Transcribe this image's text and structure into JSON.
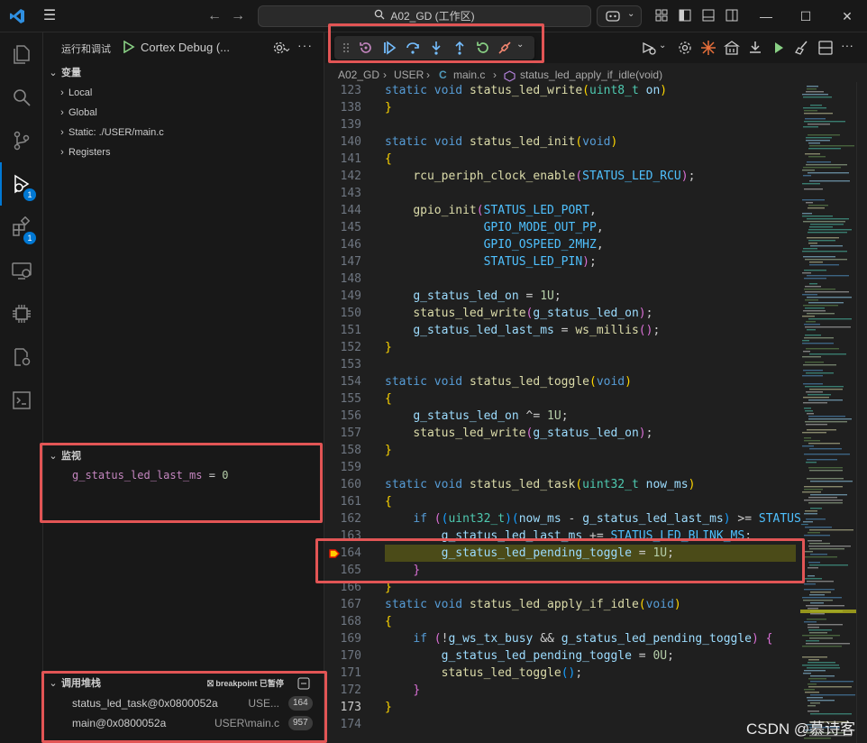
{
  "window": {
    "search_text": "A02_GD (工作区)"
  },
  "activity_bar": {
    "debug_badge": "1",
    "extensions_badge": "1"
  },
  "sidebar": {
    "title": "运行和调试",
    "config_name": "Cortex Debug (...",
    "variables": {
      "header": "变量",
      "scopes": [
        "Local",
        "Global",
        "Static: ./USER/main.c",
        "Registers"
      ]
    },
    "watch": {
      "header": "监视",
      "expression_name": "g_status_led_last_ms",
      "expression_eq": " = ",
      "expression_value": "0"
    },
    "call_stack": {
      "header": "调用堆栈",
      "status": "breakpoint 已暂停",
      "frames": [
        {
          "fn": "status_led_task@0x0800052a",
          "file": "USE...",
          "line": "164"
        },
        {
          "fn": "main@0x0800052a",
          "file": "USER\\main.c",
          "line": "957"
        }
      ]
    }
  },
  "breadcrumb": {
    "items": [
      "A02_GD",
      "USER",
      "main.c",
      "status_led_apply_if_idle(void)"
    ]
  },
  "code_lines": [
    {
      "n": "123",
      "html": "<span class=\"k\">static</span> <span class=\"k\">void</span> <span class=\"f\">status_led_write</span><span class=\"p1\">(</span><span class=\"t\">uint8_t</span> <span class=\"v\">on</span><span class=\"p1\">)</span>"
    },
    {
      "n": "138",
      "html": "<span class=\"p1\">}</span>"
    },
    {
      "n": "139",
      "html": ""
    },
    {
      "n": "140",
      "html": "<span class=\"k\">static</span> <span class=\"k\">void</span> <span class=\"f\">status_led_init</span><span class=\"p1\">(</span><span class=\"k\">void</span><span class=\"p1\">)</span>"
    },
    {
      "n": "141",
      "html": "<span class=\"p1\">{</span>"
    },
    {
      "n": "142",
      "html": "    <span class=\"f\">rcu_periph_clock_enable</span><span class=\"p2\">(</span><span class=\"m\">STATUS_LED_RCU</span><span class=\"p2\">)</span>;"
    },
    {
      "n": "143",
      "html": ""
    },
    {
      "n": "144",
      "html": "    <span class=\"f\">gpio_init</span><span class=\"p2\">(</span><span class=\"m\">STATUS_LED_PORT</span>,"
    },
    {
      "n": "145",
      "html": "              <span class=\"m\">GPIO_MODE_OUT_PP</span>,"
    },
    {
      "n": "146",
      "html": "              <span class=\"m\">GPIO_OSPEED_2MHZ</span>,"
    },
    {
      "n": "147",
      "html": "              <span class=\"m\">STATUS_LED_PIN</span><span class=\"p2\">)</span>;"
    },
    {
      "n": "148",
      "html": ""
    },
    {
      "n": "149",
      "html": "    <span class=\"v\">g_status_led_on</span> = <span class=\"n\">1U</span>;"
    },
    {
      "n": "150",
      "html": "    <span class=\"f\">status_led_write</span><span class=\"p2\">(</span><span class=\"v\">g_status_led_on</span><span class=\"p2\">)</span>;"
    },
    {
      "n": "151",
      "html": "    <span class=\"v\">g_status_led_last_ms</span> = <span class=\"f\">ws_millis</span><span class=\"p2\">()</span>;"
    },
    {
      "n": "152",
      "html": "<span class=\"p1\">}</span>"
    },
    {
      "n": "153",
      "html": ""
    },
    {
      "n": "154",
      "html": "<span class=\"k\">static</span> <span class=\"k\">void</span> <span class=\"f\">status_led_toggle</span><span class=\"p1\">(</span><span class=\"k\">void</span><span class=\"p1\">)</span>"
    },
    {
      "n": "155",
      "html": "<span class=\"p1\">{</span>"
    },
    {
      "n": "156",
      "html": "    <span class=\"v\">g_status_led_on</span> ^= <span class=\"n\">1U</span>;"
    },
    {
      "n": "157",
      "html": "    <span class=\"f\">status_led_write</span><span class=\"p2\">(</span><span class=\"v\">g_status_led_on</span><span class=\"p2\">)</span>;"
    },
    {
      "n": "158",
      "html": "<span class=\"p1\">}</span>"
    },
    {
      "n": "159",
      "html": ""
    },
    {
      "n": "160",
      "html": "<span class=\"k\">static</span> <span class=\"k\">void</span> <span class=\"f\">status_led_task</span><span class=\"p1\">(</span><span class=\"t\">uint32_t</span> <span class=\"v\">now_ms</span><span class=\"p1\">)</span>"
    },
    {
      "n": "161",
      "html": "<span class=\"p1\">{</span>"
    },
    {
      "n": "162",
      "html": "    <span class=\"k\">if</span> <span class=\"p2\">(</span><span class=\"p3\">(</span><span class=\"t\">uint32_t</span><span class=\"p3\">)(</span><span class=\"v\">now_ms</span> - <span class=\"v\">g_status_led_last_ms</span><span class=\"p3\">)</span> &gt;= <span class=\"m\">STATUS_</span>"
    },
    {
      "n": "163",
      "html": "        <span class=\"v\">g_status_led_last_ms</span> += <span class=\"m\">STATUS_LED_BLINK_MS</span>;"
    },
    {
      "n": "164",
      "html": "        <span class=\"v\">g_status_led_pending_toggle</span> = <span class=\"n\">1U</span>;",
      "current": true
    },
    {
      "n": "165",
      "html": "    <span class=\"p2\">}</span>"
    },
    {
      "n": "166",
      "html": "<span class=\"p1\">}</span>"
    },
    {
      "n": "167",
      "html": "<span class=\"k\">static</span> <span class=\"k\">void</span> <span class=\"f\">status_led_apply_if_idle</span><span class=\"p1\">(</span><span class=\"k\">void</span><span class=\"p1\">)</span>"
    },
    {
      "n": "168",
      "html": "<span class=\"p1\">{</span>"
    },
    {
      "n": "169",
      "html": "    <span class=\"k\">if</span> <span class=\"p2\">(</span>!<span class=\"v\">g_ws_tx_busy</span> &amp;&amp; <span class=\"v\">g_status_led_pending_toggle</span><span class=\"p2\">)</span> <span class=\"p2\">{</span>"
    },
    {
      "n": "170",
      "html": "        <span class=\"v\">g_status_led_pending_toggle</span> = <span class=\"n\">0U</span>;"
    },
    {
      "n": "171",
      "html": "        <span class=\"f\">status_led_toggle</span><span class=\"p3\">()</span>;"
    },
    {
      "n": "172",
      "html": "    <span class=\"p2\">}</span>"
    },
    {
      "n": "173",
      "html": "<span class=\"p1\">}</span>"
    },
    {
      "n": "174",
      "html": ""
    }
  ],
  "watermark": "CSDN @慕诗客",
  "colors": {
    "accent": "#0078d4",
    "highlight_box": "#e25555",
    "current_line": "#4b4b18"
  }
}
